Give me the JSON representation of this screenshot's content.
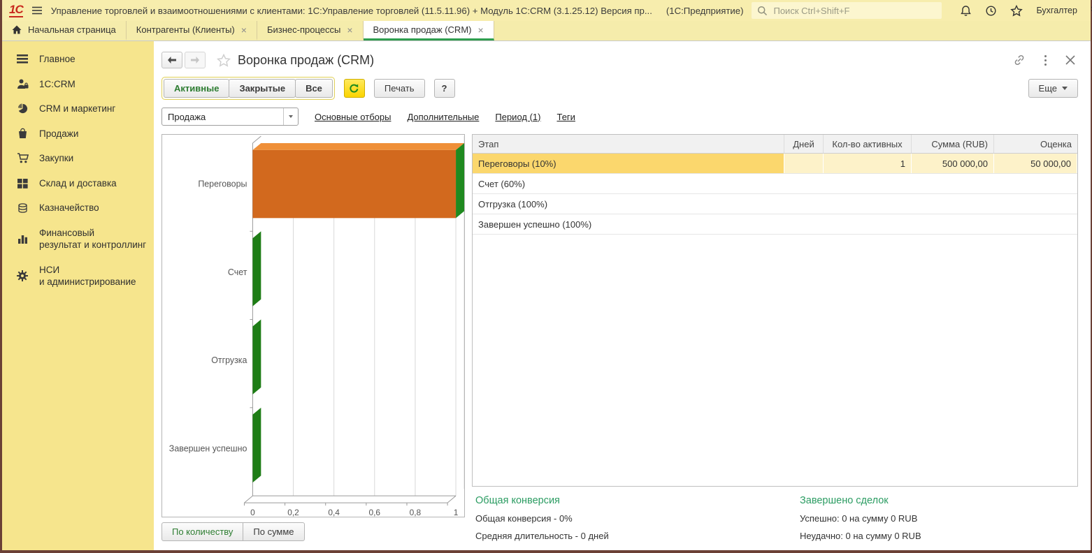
{
  "window": {
    "logo": "1С",
    "title": "Управление торговлей и взаимоотношениями с клиентами: 1С:Управление торговлей (11.5.11.96) + Модуль 1С:CRM (3.1.25.12) Версия пр...",
    "badge": "(1С:Предприятие)",
    "search_placeholder": "Поиск Ctrl+Shift+F",
    "user": "Бухгалтер"
  },
  "tabs": {
    "home": "Начальная страница",
    "close_glyph": "×",
    "items": [
      {
        "label": "Контрагенты (Клиенты)"
      },
      {
        "label": "Бизнес-процессы"
      },
      {
        "label": "Воронка продаж (CRM)"
      }
    ]
  },
  "sidebar": {
    "items": [
      {
        "icon": "menu-icon",
        "label": "Главное"
      },
      {
        "icon": "person-icon",
        "label": "1С:CRM"
      },
      {
        "icon": "pie-chart-icon",
        "label": "CRM и маркетинг"
      },
      {
        "icon": "bag-icon",
        "label": "Продажи"
      },
      {
        "icon": "cart-icon",
        "label": "Закупки"
      },
      {
        "icon": "grid-icon",
        "label": "Склад и доставка"
      },
      {
        "icon": "coins-icon",
        "label": "Казначейство"
      },
      {
        "icon": "bar-chart-icon",
        "label": "Финансовый\nрезультат и контроллинг"
      },
      {
        "icon": "gear-icon",
        "label": "НСИ\nи администрирование"
      }
    ]
  },
  "page": {
    "title": "Воронка продаж (CRM)",
    "more_label": "Еще"
  },
  "toolbar": {
    "segments": [
      "Активные",
      "Закрытые",
      "Все"
    ],
    "active_segment": "Активные",
    "print_label": "Печать",
    "help_label": "?"
  },
  "filters": {
    "selected": "Продажа",
    "links": [
      "Основные отборы",
      "Дополнительные",
      "Период (1)",
      "Теги"
    ]
  },
  "chart_data": {
    "type": "bar",
    "orientation": "horizontal",
    "title": "",
    "categories": [
      "Переговоры",
      "Счет",
      "Отгрузка",
      "Завершен успешно"
    ],
    "values": [
      1,
      0,
      0,
      0
    ],
    "xlim": [
      0,
      1
    ],
    "x_ticks": [
      "0",
      "0,2",
      "0,4",
      "0,6",
      "0,8",
      "1"
    ],
    "grid": true,
    "legend": "none",
    "colors": {
      "bar_front": "#d2691e",
      "bar_top": "#ef8f38",
      "bar_side": "#1f8a1f",
      "zero_bar": "#1e7d16",
      "axis": "#9a9a9a",
      "gridline": "#d8d8d8",
      "label": "#555555"
    }
  },
  "chart_toggle": {
    "by_count": "По количеству",
    "by_sum": "По сумме"
  },
  "table": {
    "columns": [
      "Этап",
      "Дней",
      "Кол-во активных",
      "Сумма (RUB)",
      "Оценка"
    ],
    "rows": [
      {
        "stage": "Переговоры (10%)",
        "days": "",
        "active_count": "1",
        "sum": "500 000,00",
        "estimate": "50 000,00"
      },
      {
        "stage": "Счет (60%)",
        "days": "",
        "active_count": "",
        "sum": "",
        "estimate": ""
      },
      {
        "stage": "Отгрузка (100%)",
        "days": "",
        "active_count": "",
        "sum": "",
        "estimate": ""
      },
      {
        "stage": "Завершен успешно (100%)",
        "days": "",
        "active_count": "",
        "sum": "",
        "estimate": ""
      }
    ]
  },
  "stats": {
    "conversion": {
      "title": "Общая конверсия",
      "line1": "Общая конверсия - 0%",
      "line2": "Средняя длительность - 0 дней"
    },
    "closed": {
      "title": "Завершено сделок",
      "line1": "Успешно: 0 на сумму 0 RUB",
      "line2": "Неудачно: 0 на сумму 0 RUB"
    }
  },
  "colors": {
    "accent_green": "#2e7d32",
    "stats_green": "#2b9c62",
    "tab_underline_green": "#2f9e4f",
    "selected_row_gold": "#fbd76d",
    "selected_row_pale": "#fdf2c9",
    "titlebar_bg": "#f7edad",
    "sidebar_bg": "#f6e58d",
    "refresh_yellow": "#fbd400",
    "logo_red": "#c8281e"
  }
}
